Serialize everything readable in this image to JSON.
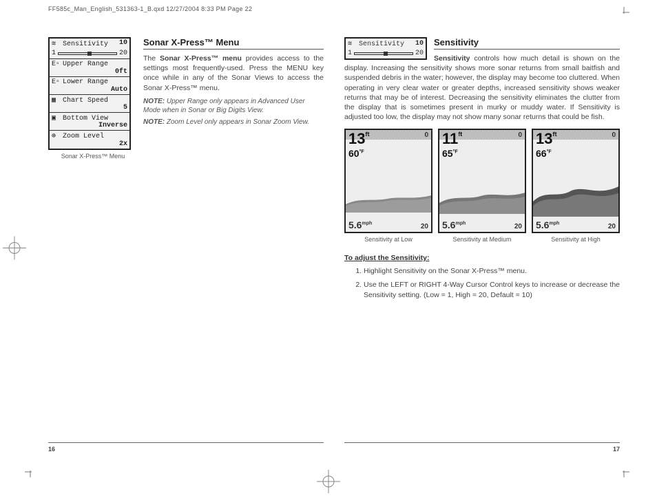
{
  "print_header": "FF585c_Man_English_531363-1_B.qxd  12/27/2004  8:33 PM  Page 22",
  "page_numbers": {
    "left": "16",
    "right": "17"
  },
  "left_page": {
    "heading": "Sonar X-Press™ Menu",
    "para1_a": "The ",
    "para1_bold": "Sonar X-Press™ menu",
    "para1_b": " provides access to the settings most frequently-used. Press the MENU key once while in any of the Sonar Views to access the Sonar X-Press™ menu.",
    "note1_label": "NOTE:",
    "note1": " Upper Range only appears in Advanced User Mode when in Sonar or Big Digits View.",
    "note2_label": "NOTE:",
    "note2": " Zoom Level only appears in Sonar Zoom View.",
    "menu_caption": "Sonar X-Press™ Menu",
    "menu": {
      "sensitivity_label": "Sensitivity",
      "sensitivity_value": "10",
      "slider_min": "1",
      "slider_max": "20",
      "upper_label": "Upper Range",
      "upper_value": "0ft",
      "lower_label": "Lower Range",
      "lower_value": "Auto",
      "chart_label": "Chart Speed",
      "chart_value": "5",
      "bottom_label": "Bottom View",
      "bottom_value": "Inverse",
      "zoom_label": "Zoom Level",
      "zoom_value": "2x"
    }
  },
  "right_page": {
    "heading": "Sensitivity",
    "mini_menu": {
      "label": "Sensitivity",
      "value": "10",
      "slider_min": "1",
      "slider_max": "20"
    },
    "para_a": "Sensitivity",
    "para_b": " controls how much detail is shown on the display. Increasing the sensitivity shows more sonar returns from small baitfish and suspended debris in the water; however, the display may become too cluttered. When operating in very clear water or greater depths, increased sensitivity shows weaker returns that may be of interest. Decreasing the sensitivity eliminates the clutter from the display that is sometimes present in murky or muddy water. If Sensitivity is adjusted too low, the display may not show many sonar returns that could be fish.",
    "sonar_screens": [
      {
        "depth": "13",
        "depth_unit": "ft",
        "temp": "60",
        "temp_unit": "°F",
        "zero": "0",
        "bottom": "20",
        "speed": "5.6",
        "speed_unit": "mph",
        "caption": "Sensitivity at Low"
      },
      {
        "depth": "11",
        "depth_unit": "ft",
        "temp": "65",
        "temp_unit": "°F",
        "zero": "0",
        "bottom": "20",
        "speed": "5.6",
        "speed_unit": "mph",
        "caption": "Sensitivity at Medium"
      },
      {
        "depth": "13",
        "depth_unit": "ft",
        "temp": "66",
        "temp_unit": "°F",
        "zero": "0",
        "bottom": "20",
        "speed": "5.6",
        "speed_unit": "mph",
        "caption": "Sensitivity at High"
      }
    ],
    "adjust_heading": "To adjust the Sensitivity:",
    "step1": "Highlight Sensitivity on the Sonar X-Press™ menu.",
    "step2": "Use the LEFT or RIGHT 4-Way Cursor Control keys to increase or decrease the Sensitivity setting. (Low = 1, High = 20, Default = 10)"
  }
}
